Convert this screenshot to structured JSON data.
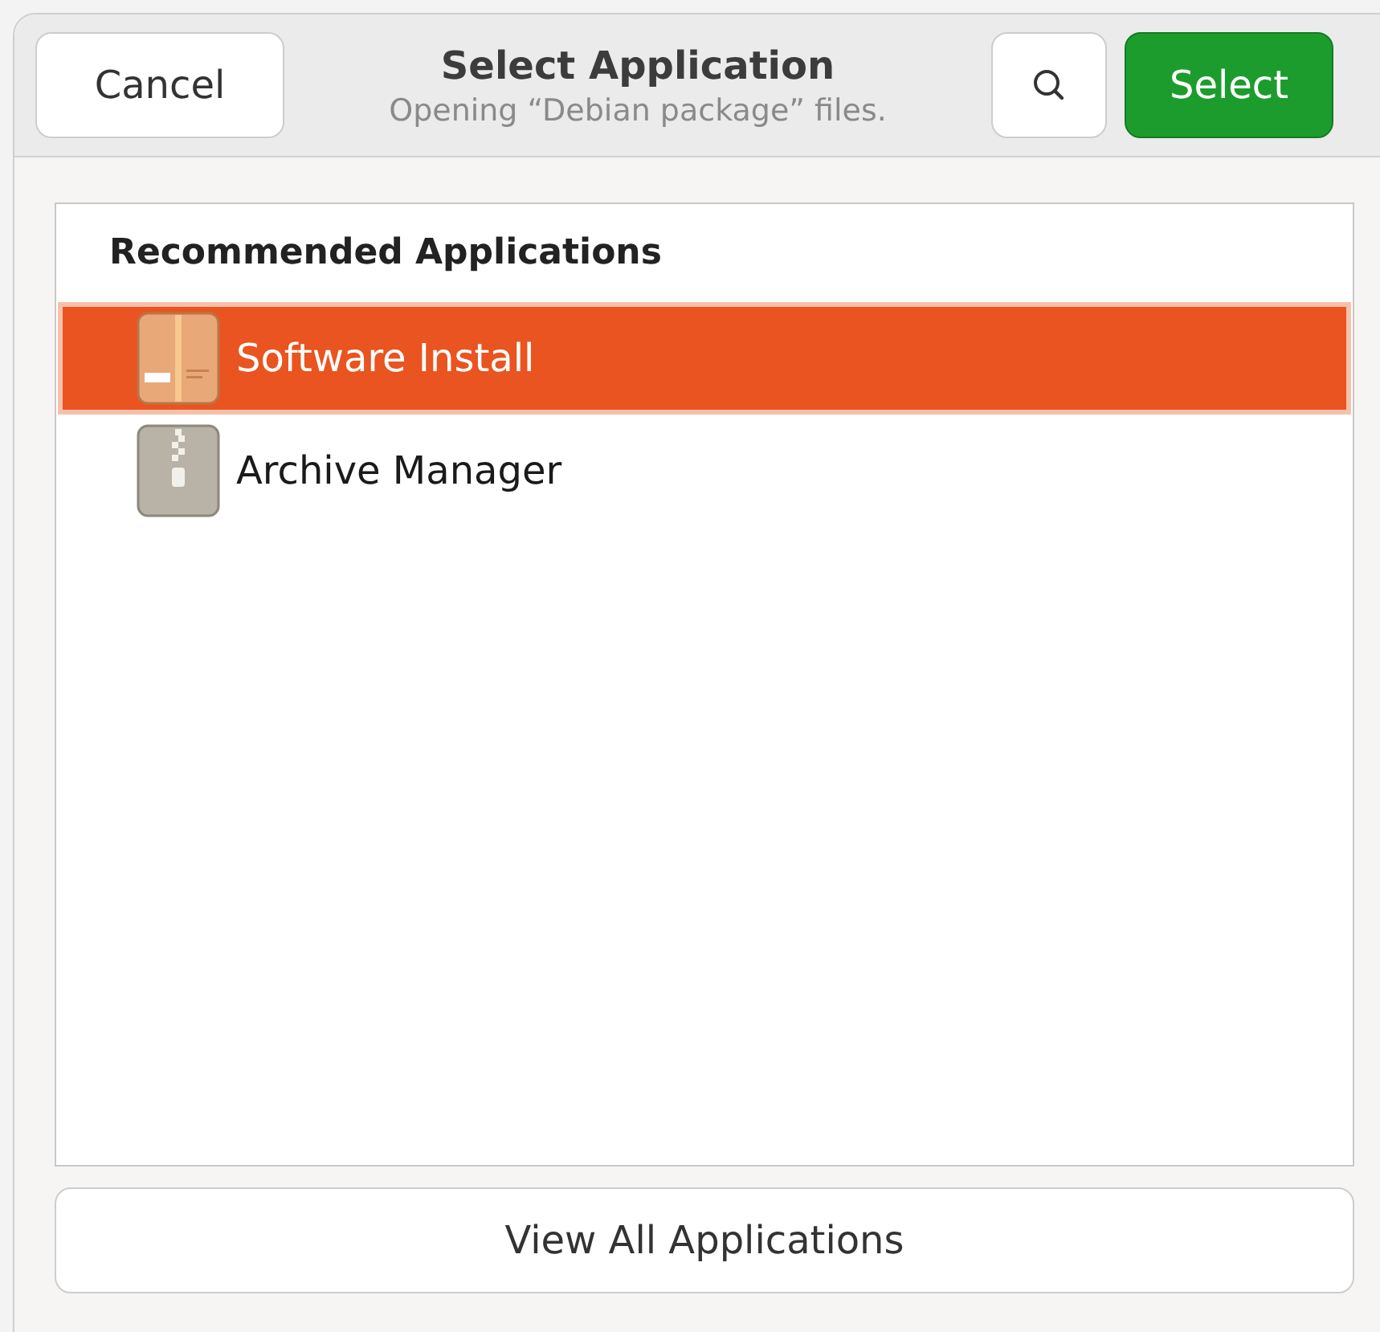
{
  "header": {
    "cancel": "Cancel",
    "title": "Select Application",
    "subtitle": "Opening “Debian package” files.",
    "select": "Select"
  },
  "list": {
    "heading": "Recommended Applications",
    "items": [
      {
        "label": "Software Install",
        "kind": "package",
        "selected": true
      },
      {
        "label": "Archive Manager",
        "kind": "archive",
        "selected": false
      }
    ]
  },
  "footer_button": "View All Applications"
}
